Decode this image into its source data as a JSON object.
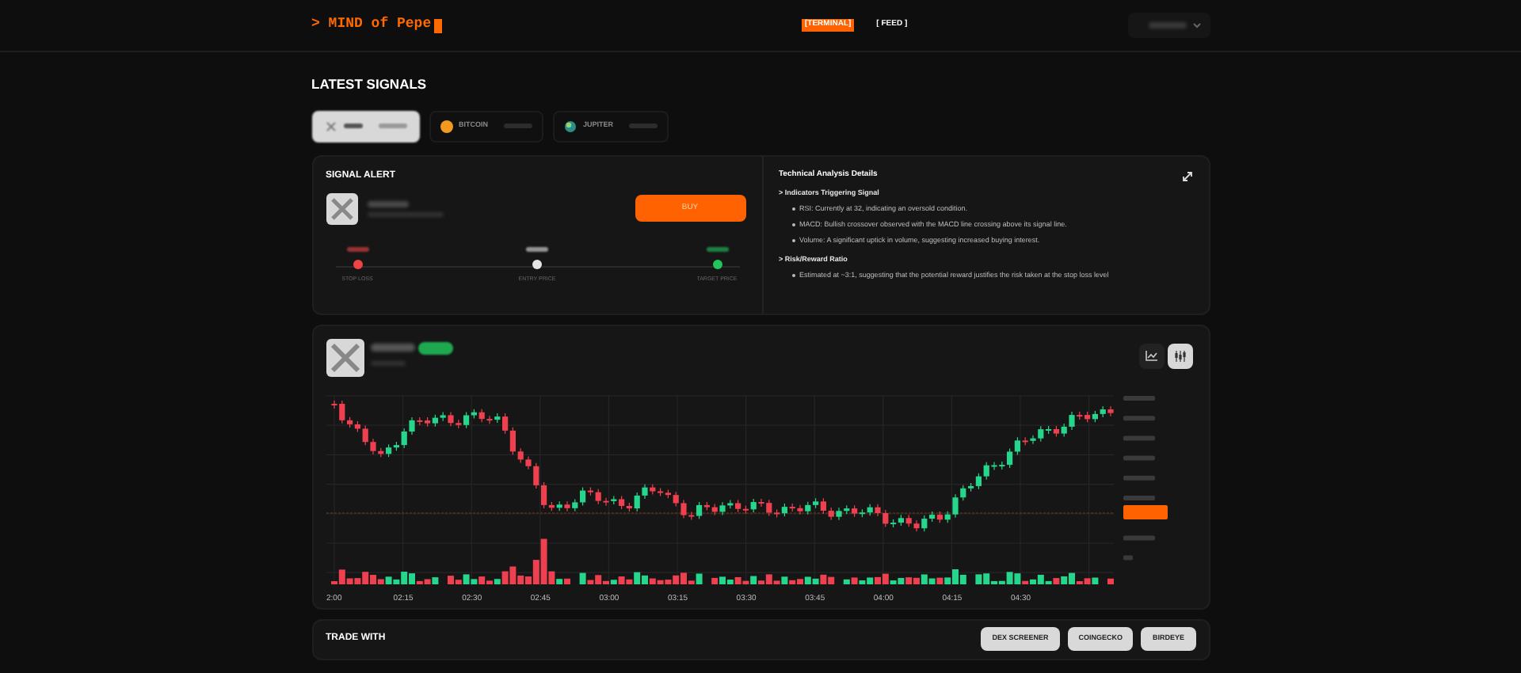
{
  "header": {
    "logo": "> MIND of Pepe",
    "nav": [
      {
        "label": "[TERMINAL]",
        "selected": true
      },
      {
        "label": "[ FEED ]",
        "selected": false
      }
    ]
  },
  "section_title": "LATEST SIGNALS",
  "tokens": [
    {
      "selected": true,
      "kind": "x"
    },
    {
      "name": "BITCOIN",
      "selected": false,
      "kind": "coin"
    },
    {
      "name": "JUPITER",
      "selected": false,
      "kind": "orb"
    }
  ],
  "signal_alert": {
    "title": "SIGNAL ALERT",
    "action": "BUY",
    "levels": [
      {
        "label": "STOP LOSS",
        "color": "#ef4444"
      },
      {
        "label": "ENTRY PRICE",
        "color": "#e5e5e5"
      },
      {
        "label": "TARGET PRICE",
        "color": "#22c55e"
      }
    ]
  },
  "analysis": {
    "title": "Technical Analysis Details",
    "sections": [
      {
        "heading": "> Indicators Triggering Signal",
        "items": [
          "RSI: Currently at 32, indicating an oversold condition.",
          "MACD: Bullish crossover observed with the MACD line crossing above its signal line.",
          "Volume: A significant uptick in volume, suggesting increased buying interest."
        ]
      },
      {
        "heading": "> Risk/Reward Ratio",
        "items": [
          "Estimated at ~3:1, suggesting that the potential reward justifies the risk taken at the stop loss level"
        ]
      }
    ]
  },
  "chart": {
    "views": [
      {
        "kind": "line",
        "selected": false
      },
      {
        "kind": "candles",
        "selected": true
      }
    ],
    "x_ticks": [
      "2:00",
      "02:15",
      "02:30",
      "02:45",
      "03:00",
      "03:15",
      "03:30",
      "03:45",
      "04:00",
      "04:15",
      "04:30"
    ]
  },
  "trade_with": {
    "title": "TRADE WITH",
    "buttons": [
      "DEX SCREENER",
      "COINGECKO",
      "BIRDEYE"
    ]
  }
}
